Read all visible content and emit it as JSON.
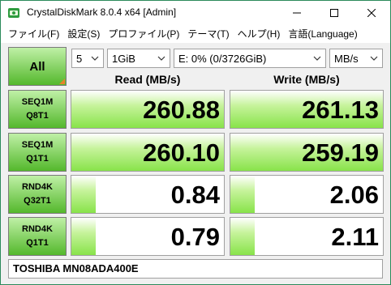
{
  "window": {
    "title": "CrystalDiskMark 8.0.4 x64 [Admin]"
  },
  "menu": [
    "ファイル(F)",
    "設定(S)",
    "プロファイル(P)",
    "テーマ(T)",
    "ヘルプ(H)",
    "言語(Language)"
  ],
  "toolbar": {
    "all_label": "All",
    "count": "5",
    "size": "1GiB",
    "drive": "E: 0% (0/3726GiB)",
    "unit": "MB/s"
  },
  "headers": {
    "read": "Read (MB/s)",
    "write": "Write (MB/s)"
  },
  "tests": [
    {
      "line1": "SEQ1M",
      "line2": "Q8T1",
      "read": "260.88",
      "write": "261.13",
      "read_level": 1.0,
      "write_level": 1.0
    },
    {
      "line1": "SEQ1M",
      "line2": "Q1T1",
      "read": "260.10",
      "write": "259.19",
      "read_level": 1.0,
      "write_level": 1.0
    },
    {
      "line1": "RND4K",
      "line2": "Q32T1",
      "read": "0.84",
      "write": "2.06",
      "read_level": 0.16,
      "write_level": 0.16
    },
    {
      "line1": "RND4K",
      "line2": "Q1T1",
      "read": "0.79",
      "write": "2.11",
      "read_level": 0.16,
      "write_level": 0.16
    }
  ],
  "drive_name": "TOSHIBA MN08ADA400E",
  "colors": {
    "accent_border": "#2b8a5b",
    "button_top": "#bff0a6",
    "button_bottom": "#54b82c",
    "bar_green": "#88e34a",
    "corner_orange": "#e8822a"
  }
}
